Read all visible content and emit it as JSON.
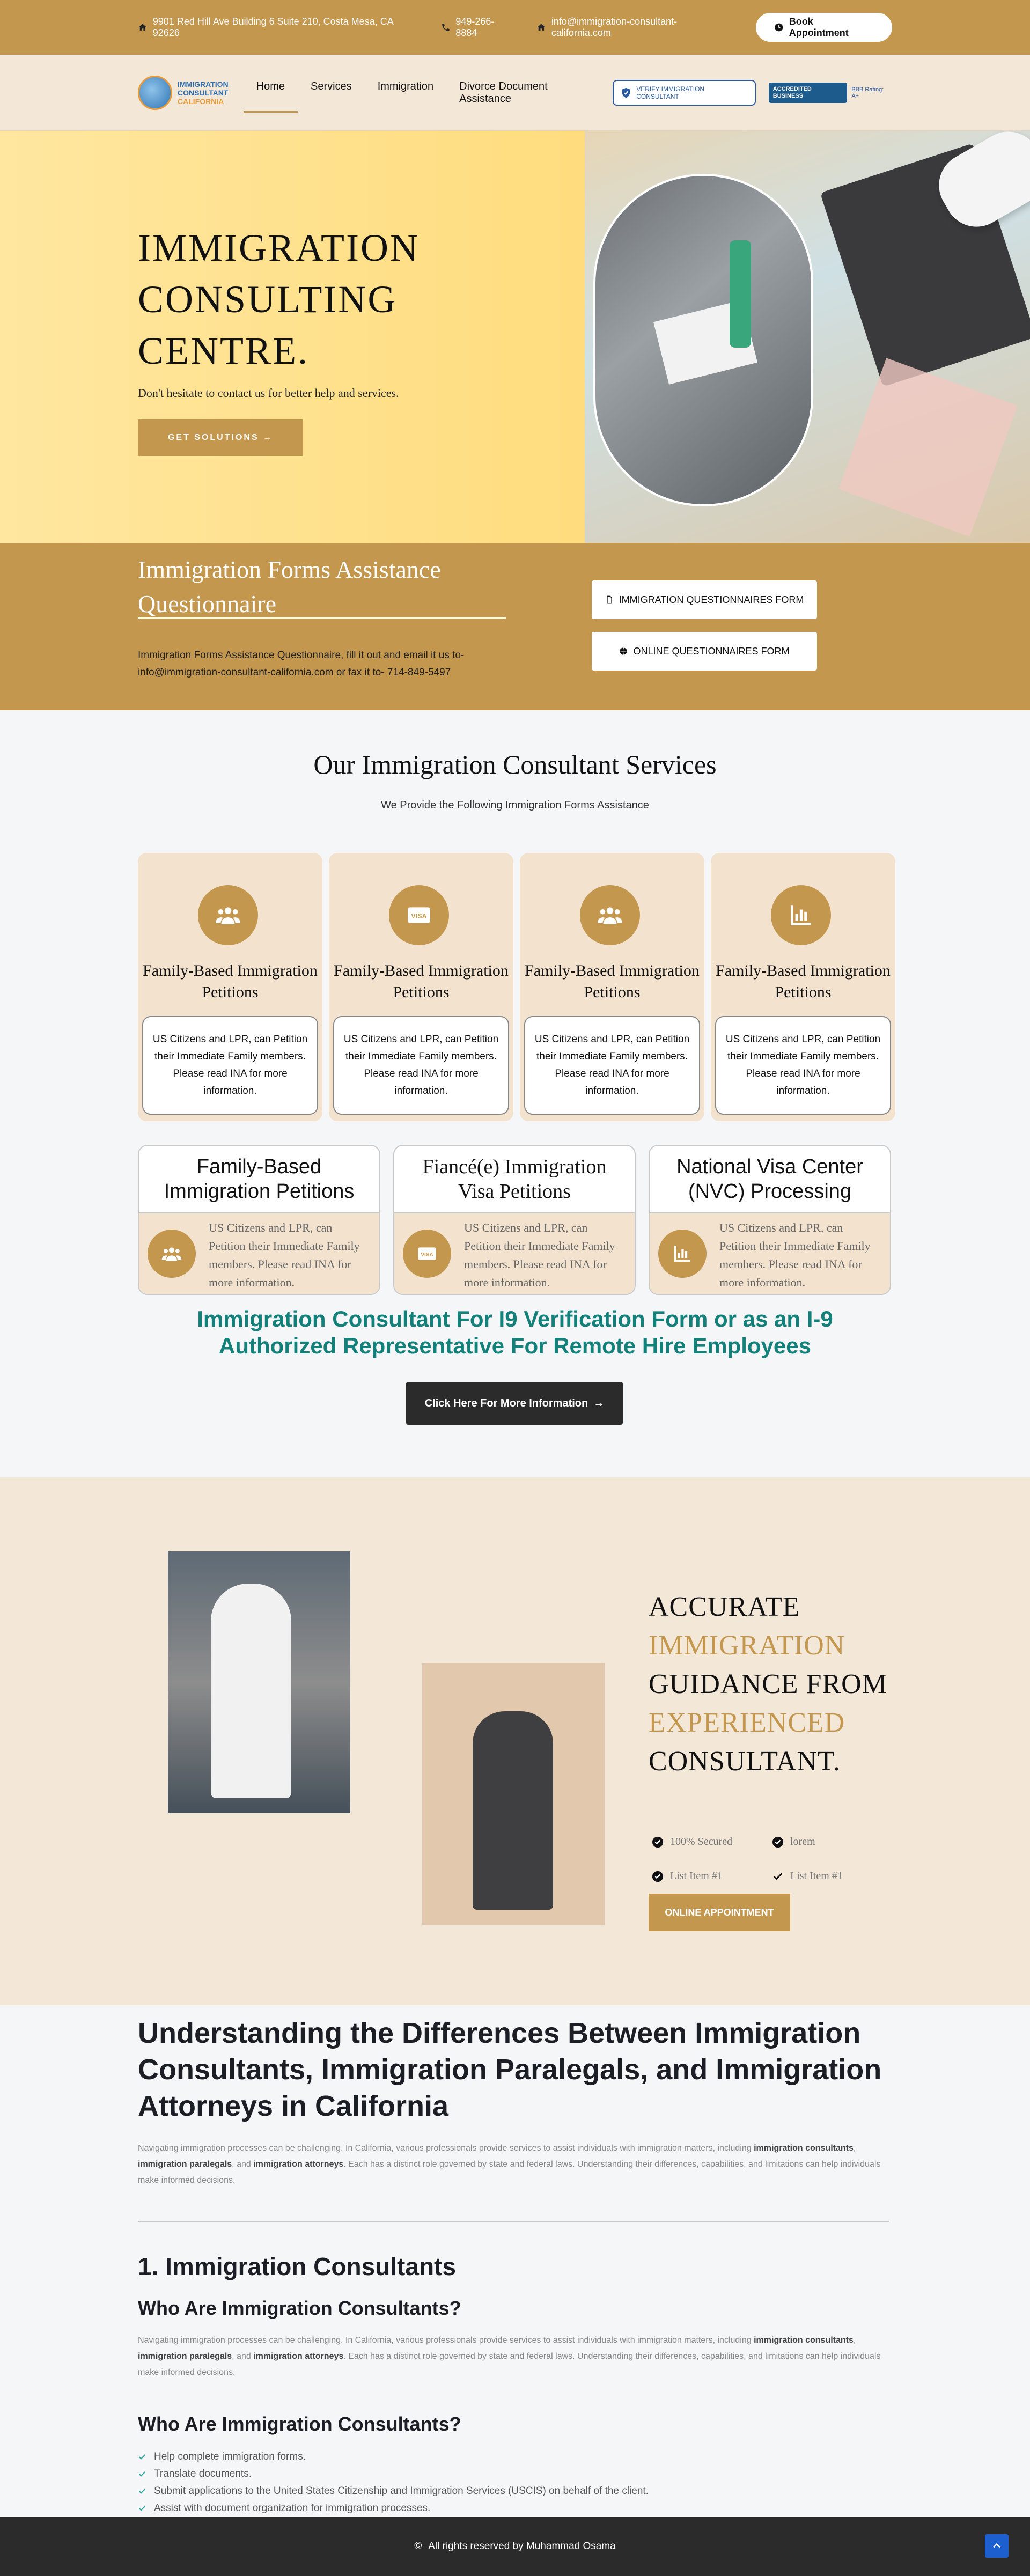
{
  "topbar": {
    "address": "9901 Red Hill Ave Building 6 Suite 210, Costa Mesa, CA 92626",
    "phone": "949-266-8884",
    "email": "info@immigration-consultant-california.com",
    "book_label": "Book Appointment"
  },
  "nav": {
    "logo_line1": "IMMIGRATION",
    "logo_line2": "CONSULTANT",
    "logo_line3": "CALIFORNIA",
    "items": [
      {
        "label": "Home"
      },
      {
        "label": "Services"
      },
      {
        "label": "Immigration"
      },
      {
        "label": "Divorce Document Assistance"
      }
    ],
    "badge_verify": "VERIFY IMMIGRATION CONSULTANT",
    "bbb_label": "ACCREDITED BUSINESS",
    "bbb_rating": "BBB Rating: A+"
  },
  "hero": {
    "title": "IMMIGRATION CONSULTING CENTRE.",
    "subtitle": "Don't hesitate to contact us for better help and services.",
    "cta": "GET SOLUTIONS"
  },
  "forms": {
    "title": "Immigration Forms Assistance Questionnaire",
    "body": "Immigration Forms Assistance Questionnaire, fill it out and email it us to- info@immigration-consultant-california.com or fax it to- 714-849-5497",
    "btn1": "IMMIGRATION QUESTIONNAIRES FORM",
    "btn2": "ONLINE QUESTIONNAIRES FORM"
  },
  "services": {
    "title": "Our Immigration Consultant Services",
    "subtitle": "We Provide the Following Immigration Forms Assistance",
    "cards": [
      {
        "title": "Family-Based Immigration Petitions",
        "body": "US Citizens and LPR, can Petition their Immediate Family members. Please read INA for more information.",
        "icon": "users-icon"
      },
      {
        "title": "Family-Based Immigration Petitions",
        "body": "US Citizens and LPR, can Petition their Immediate Family members. Please read INA for more information.",
        "icon": "visa-icon"
      },
      {
        "title": "Family-Based Immigration Petitions",
        "body": "US Citizens and LPR, can Petition their Immediate Family members. Please read INA for more information.",
        "icon": "users-icon"
      },
      {
        "title": "Family-Based Immigration Petitions",
        "body": "US Citizens and LPR, can Petition their Immediate Family members. Please read INA for more information.",
        "icon": "chart-icon"
      }
    ],
    "cards2": [
      {
        "title": "Family-Based Immigration Petitions",
        "body": "US Citizens and LPR, can Petition their Immediate Family members. Please read INA for more information.",
        "icon": "users-icon"
      },
      {
        "title": "Fiancé(e) Immigration Visa Petitions",
        "body": "US Citizens and LPR, can Petition their Immediate Family members. Please read INA for more information.",
        "icon": "visa-icon"
      },
      {
        "title": "National Visa Center (NVC) Processing",
        "body": "US Citizens and LPR, can Petition their Immediate Family members. Please read INA for more information.",
        "icon": "chart-icon"
      }
    ],
    "i9_heading": "Immigration Consultant For I9 Verification Form or as an I-9 Authorized Representative For Remote Hire Employees",
    "more_btn": "Click Here For More Information"
  },
  "accurate": {
    "line1": "ACCURATE",
    "line2": "IMMIGRATION",
    "line3": "GUIDANCE FROM",
    "line4": "EXPERIENCED",
    "line5": "CONSULTANT.",
    "checks": [
      "100% Secured",
      "lorem",
      "List Item #1",
      "List Item #1"
    ],
    "btn": "ONLINE APPOINTMENT"
  },
  "article": {
    "h2": "Understanding the Differences Between Immigration Consultants, Immigration Paralegals, and Immigration Attorneys in California",
    "intro_a": "Navigating immigration processes can be challenging. In California, various professionals provide services to assist individuals with immigration matters, including ",
    "intro_b1": "immigration consultants",
    "intro_c": ", ",
    "intro_b2": "immigration paralegals",
    "intro_d": ", and ",
    "intro_b3": "immigration attorneys",
    "intro_e": ". Each has a distinct role governed by state and federal laws. Understanding their differences, capabilities, and limitations can help individuals make informed decisions.",
    "h3": "1. Immigration Consultants",
    "h4a": "Who Are Immigration Consultants?",
    "h4b": "Who Are Immigration Consultants?",
    "list": [
      "Help complete immigration forms.",
      "Translate documents.",
      "Submit applications to the United States Citizenship and Immigration Services (USCIS) on behalf of the client.",
      "Assist with document organization for immigration processes."
    ]
  },
  "footer": {
    "copyright_symbol": "©",
    "text": "All rights reserved by Muhammad Osama"
  },
  "colors": {
    "gold": "#c4974f",
    "cream": "#f3e7d7",
    "teal": "#14807a",
    "dark": "#2b2b2b"
  }
}
